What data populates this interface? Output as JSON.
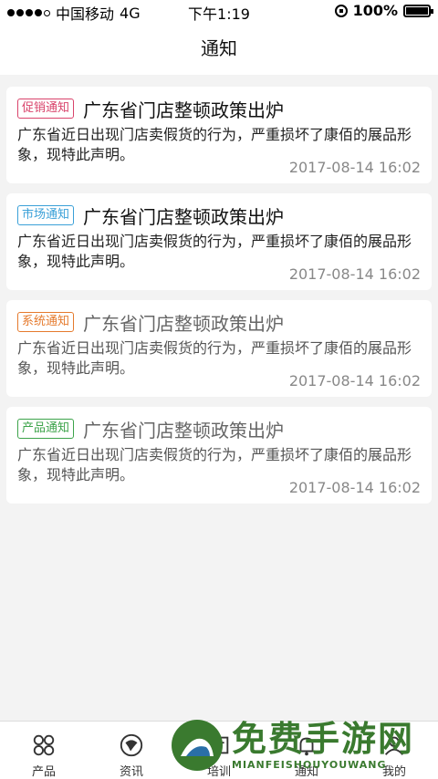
{
  "status": {
    "carrier": "中国移动",
    "network": "4G",
    "time": "下午1:19",
    "battery": "100%"
  },
  "nav": {
    "title": "通知"
  },
  "notices": [
    {
      "tag": "促销通知",
      "tag_color": "#d9436b",
      "title": "广东省门店整顿政策出炉",
      "body": "广东省近日出现门店卖假货的行为，严重损坏了康佰的展品形象，现特此声明。",
      "time": "2017-08-14 16:02",
      "read": false
    },
    {
      "tag": "市场通知",
      "tag_color": "#3aa0d8",
      "title": "广东省门店整顿政策出炉",
      "body": "广东省近日出现门店卖假货的行为，严重损坏了康佰的展品形象，现特此声明。",
      "time": "2017-08-14 16:02",
      "read": false
    },
    {
      "tag": "系统通知",
      "tag_color": "#e57a2d",
      "title": "广东省门店整顿政策出炉",
      "body": "广东省近日出现门店卖假货的行为，严重损坏了康佰的展品形象，现特此声明。",
      "time": "2017-08-14 16:02",
      "read": true
    },
    {
      "tag": "产品通知",
      "tag_color": "#3ca34a",
      "title": "广东省门店整顿政策出炉",
      "body": "广东省近日出现门店卖假货的行为，严重损坏了康佰的展品形象，现特此声明。",
      "time": "2017-08-14 16:02",
      "read": true
    }
  ],
  "tabs": [
    {
      "label": "产品",
      "icon": "products-icon"
    },
    {
      "label": "资讯",
      "icon": "news-icon"
    },
    {
      "label": "培训",
      "icon": "training-icon"
    },
    {
      "label": "通知",
      "icon": "notice-icon"
    },
    {
      "label": "我的",
      "icon": "profile-icon"
    }
  ],
  "watermark": {
    "main": "免费手游网",
    "sub": "MIANFEISHOUYOUWANG"
  }
}
